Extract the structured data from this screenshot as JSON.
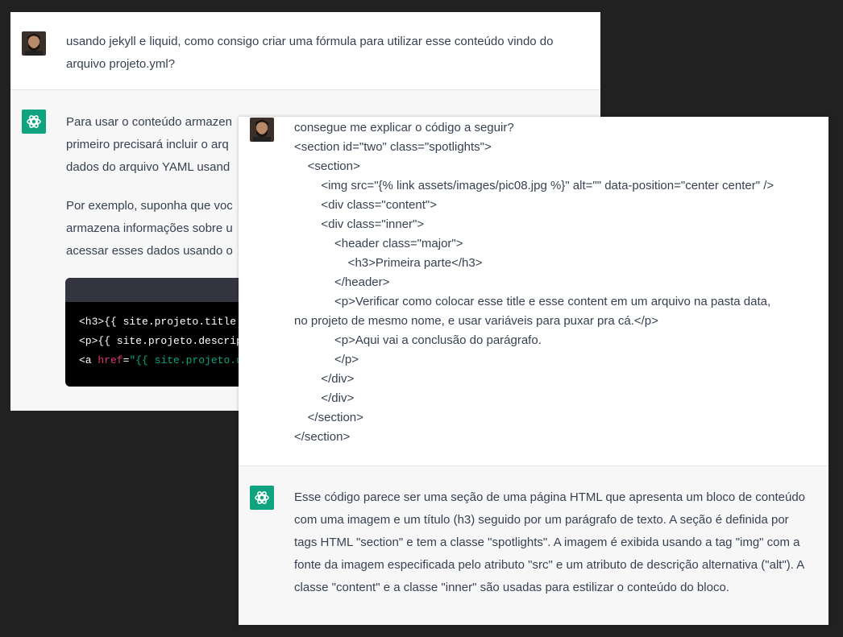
{
  "back": {
    "user_message": "usando jekyll e liquid, como consigo criar uma fórmula para utilizar esse conteúdo vindo do arquivo projeto.yml?",
    "assistant_paragraphs": [
      "Para usar o conteúdo armazen",
      "primeiro precisará incluir o arq",
      "dados do arquivo YAML usand",
      "Por exemplo, suponha que voc",
      "armazena informações sobre u",
      "acessar esses dados usando o"
    ],
    "code": {
      "line1": "<h3>{{ site.projeto.title",
      "line2": "<p>{{ site.projeto.descrip",
      "line3_tag": "<a ",
      "line3_attr": "href",
      "line3_eq": "=",
      "line3_str": "\"{{ site.projeto.u"
    }
  },
  "front": {
    "user_lines": [
      "consegue me explicar o código a seguir?",
      "<section id=\"two\" class=\"spotlights\">",
      "    <section>",
      "        <img src=\"{% link assets/images/pic08.jpg %}\" alt=\"\" data-position=\"center center\" />",
      "        <div class=\"content\">",
      "        <div class=\"inner\">",
      "            <header class=\"major\">",
      "                <h3>Primeira parte</h3>",
      "            </header>",
      "            <p>Verificar como colocar esse title e esse content em um arquivo na pasta data,",
      "no projeto de mesmo nome, e usar variáveis para puxar pra cá.</p>",
      "            <p>Aqui vai a conclusão do parágrafo.",
      "            </p>",
      "        </div>",
      "        </div>",
      "    </section>",
      "</section>"
    ],
    "assistant_text": "Esse código parece ser uma seção de uma página HTML que apresenta um bloco de conteúdo com uma imagem e um título (h3) seguido por um parágrafo de texto. A seção é definida por tags HTML \"section\" e tem a classe \"spotlights\". A imagem é exibida usando a tag \"img\" com a fonte da imagem especificada pelo atributo \"src\" e um atributo de descrição alternativa (\"alt\"). A classe \"content\" e a classe \"inner\" são usadas para estilizar o conteúdo do bloco."
  },
  "colors": {
    "background": "#212121",
    "assistant_row": "#f7f7f8",
    "accent": "#10a37f",
    "text": "#374151"
  },
  "icons": {
    "user_avatar": "user-avatar",
    "assistant_avatar": "openai-logo-icon"
  }
}
